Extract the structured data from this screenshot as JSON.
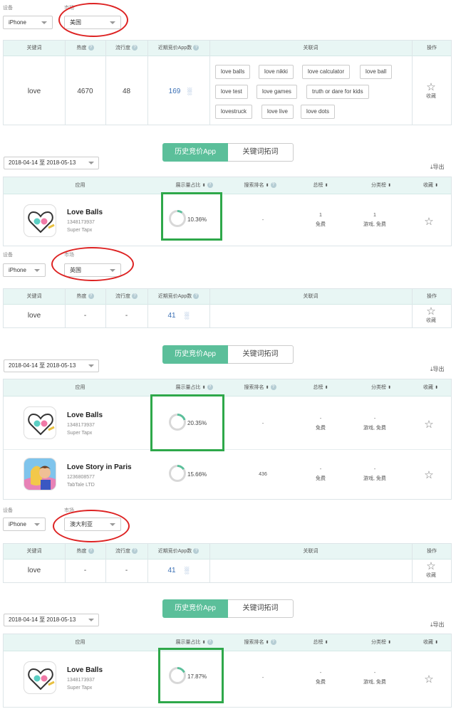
{
  "labels": {
    "device": "设备",
    "market": "市场"
  },
  "kw_headers": {
    "keyword": "关键词",
    "heat": "热度",
    "flow": "流行度",
    "recent": "近期竞价App数",
    "related": "关联词",
    "action": "操作"
  },
  "app_headers": {
    "app": "应用",
    "share": "展示量占比",
    "rank": "搜索排名",
    "total": "总榜",
    "category": "分类榜",
    "fav": "收藏"
  },
  "tabs": {
    "history": "历史竞价App",
    "expand": "关键词拓词"
  },
  "export_label": "导出",
  "fav_label": "收藏",
  "qmark": "?",
  "star": "☆",
  "colors": {
    "accent": "#5bbf9a",
    "ring": "#d22222",
    "box": "#2ea84a"
  },
  "sections": [
    {
      "device": "iPhone",
      "market": "美国",
      "keyword": "love",
      "heat": "4670",
      "flow": "48",
      "recent": "169",
      "related": [
        "love balls",
        "love nikki",
        "love calculator",
        "love ball",
        "love test",
        "love games",
        "truth or dare for kids",
        "lovestruck",
        "love live",
        "love dots"
      ],
      "date_range": "2018-04-14 至 2018-05-13",
      "apps": [
        {
          "name": "Love Balls",
          "id": "1348173937",
          "dev": "Super Tapx",
          "share": "10.36%",
          "share_value": 10.36,
          "rank": "-",
          "total": "1",
          "total_sub": "免费",
          "cat": "1",
          "cat_sub": "游戏, 免费"
        }
      ]
    },
    {
      "device": "iPhone",
      "market": "英国",
      "keyword": "love",
      "heat": "-",
      "flow": "-",
      "recent": "41",
      "related": [],
      "date_range": "2018-04-14 至 2018-05-13",
      "apps": [
        {
          "name": "Love Balls",
          "id": "1348173937",
          "dev": "Super Tapx",
          "share": "20.35%",
          "share_value": 20.35,
          "rank": "-",
          "total": "-",
          "total_sub": "免费",
          "cat": "-",
          "cat_sub": "游戏, 免费"
        },
        {
          "name": "Love Story in Paris",
          "id": "1236808577",
          "dev": "TabTale LTD",
          "share": "15.66%",
          "share_value": 15.66,
          "rank": "436",
          "total": "-",
          "total_sub": "免费",
          "cat": "-",
          "cat_sub": "游戏, 免费"
        }
      ]
    },
    {
      "device": "iPhone",
      "market": "澳大利亚",
      "keyword": "love",
      "heat": "-",
      "flow": "-",
      "recent": "41",
      "related": [],
      "date_range": "2018-04-14 至 2018-05-13",
      "apps": [
        {
          "name": "Love Balls",
          "id": "1348173937",
          "dev": "Super Tapx",
          "share": "17.87%",
          "share_value": 17.87,
          "rank": "-",
          "total": "-",
          "total_sub": "免费",
          "cat": "-",
          "cat_sub": "游戏, 免费"
        }
      ]
    }
  ]
}
